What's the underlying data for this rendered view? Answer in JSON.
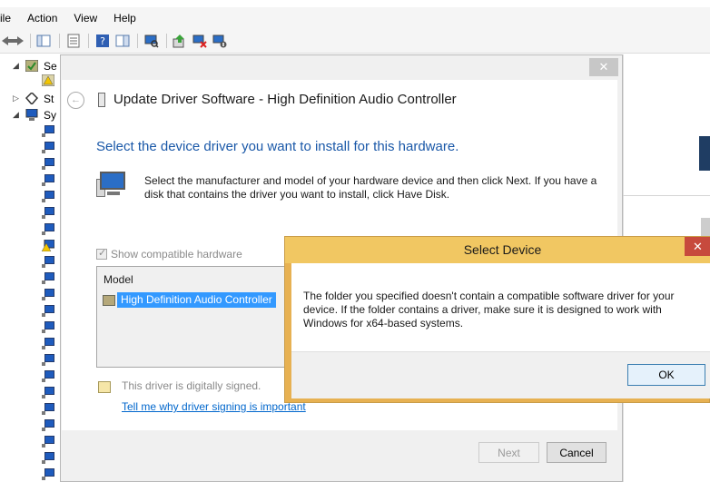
{
  "menu": [
    "ile",
    "Action",
    "View",
    "Help"
  ],
  "tree": {
    "items": [
      {
        "label": "Se",
        "expander": "◢"
      },
      {
        "label": "St",
        "expander": "▷"
      },
      {
        "label": "Sy",
        "expander": "◢"
      }
    ]
  },
  "wizard": {
    "title": "Update Driver Software - High Definition Audio Controller",
    "close_glyph": "✕",
    "back_glyph": "←",
    "heading": "Select the device driver you want to install for this hardware.",
    "instructions": "Select the manufacturer and model of your hardware device and then click Next. If you have a disk that contains the driver you want to install, click Have Disk.",
    "show_compatible_label": "Show compatible hardware",
    "model_column": "Model",
    "model_items": [
      "High Definition Audio Controller"
    ],
    "signed_text": "This driver is digitally signed.",
    "signing_link": "Tell me why driver signing is important",
    "next_label": "Next",
    "cancel_label": "Cancel"
  },
  "dialog": {
    "title": "Select Device",
    "close_glyph": "✕",
    "message": "The folder you specified doesn't contain a compatible software driver for your device. If the folder contains a driver, make sure it is designed to work with Windows for x64-based systems.",
    "ok_label": "OK"
  },
  "colors": {
    "heading_blue": "#1a58a8",
    "selection_blue": "#3399ff",
    "dialog_frame": "#f1c762",
    "close_red": "#c74a3d",
    "link_blue": "#0066cc"
  },
  "icons": [
    "back-arrow-icon",
    "forward-arrow-icon",
    "properties-icon",
    "help-icon",
    "scan-hardware-icon",
    "update-driver-icon",
    "uninstall-icon",
    "disable-icon",
    "device-icon",
    "hardware-icon",
    "certificate-icon"
  ]
}
